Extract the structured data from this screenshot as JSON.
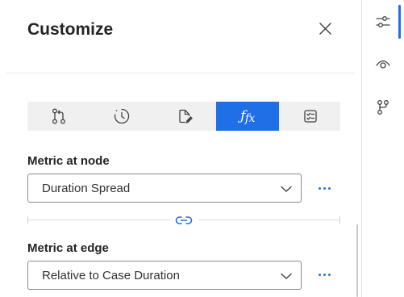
{
  "panel": {
    "title": "Customize",
    "tabs": [
      {
        "icon": "process-flow-icon",
        "active": false
      },
      {
        "icon": "clock-history-icon",
        "active": false
      },
      {
        "icon": "document-edit-icon",
        "active": false
      },
      {
        "icon": "function-fx-icon",
        "active": true,
        "label": "fx"
      },
      {
        "icon": "checklist-icon",
        "active": false
      }
    ],
    "node_metric": {
      "label": "Metric at node",
      "value": "Duration Spread"
    },
    "edge_metric": {
      "label": "Metric at edge",
      "value": "Relative to Case Duration"
    }
  },
  "rail": {
    "items": [
      {
        "icon": "settings-sliders-icon",
        "active": true
      },
      {
        "icon": "eye-icon",
        "active": false
      },
      {
        "icon": "branch-flow-icon",
        "active": false
      }
    ]
  },
  "colors": {
    "accent": "#1f6fe6",
    "tab_bg": "#f0f0f0",
    "text": "#242424"
  }
}
